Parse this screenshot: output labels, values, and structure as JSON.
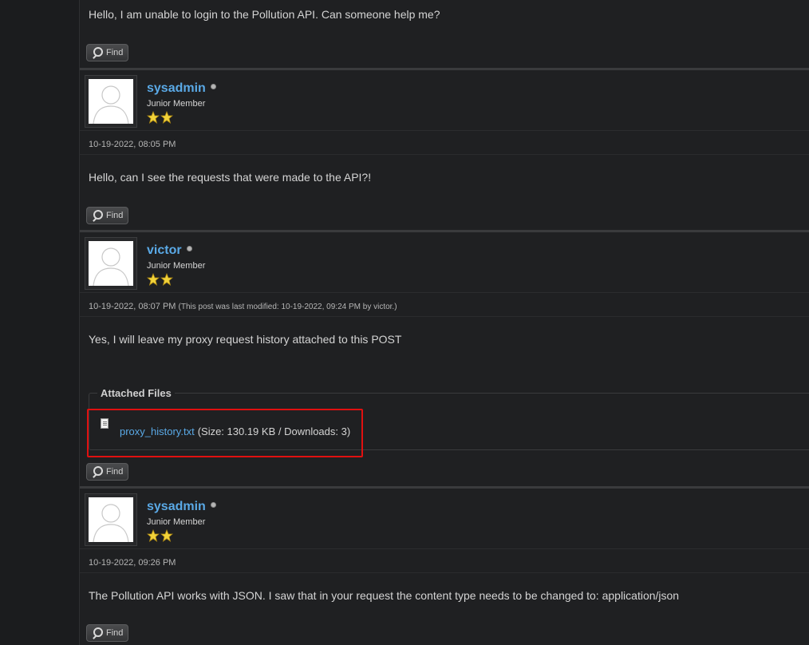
{
  "find_label": "Find",
  "posts": [
    {
      "body": "Hello, I am unable to login to the Pollution API. Can someone help me?"
    },
    {
      "author": "sysadmin",
      "usertitle": "Junior Member",
      "date": "10-19-2022, 08:05 PM",
      "body": "Hello, can I see the requests that were made to the API?!"
    },
    {
      "author": "victor",
      "usertitle": "Junior Member",
      "date": "10-19-2022, 08:07 PM",
      "modified": "(This post was last modified: 10-19-2022, 09:24 PM by victor.)",
      "body": "Yes, I will leave my proxy request history attached to this POST",
      "attachments_title": "Attached Files",
      "attachment": {
        "filename": "proxy_history.txt",
        "info": "(Size: 130.19 KB / Downloads: 3)"
      }
    },
    {
      "author": "sysadmin",
      "usertitle": "Junior Member",
      "date": "10-19-2022, 09:26 PM",
      "body": "The Pollution API works with JSON. I saw that in your request the content type needs to be changed to: application/json"
    }
  ],
  "colors": {
    "username": "#5aa9e6",
    "highlight": "#e01010",
    "background": "#1f2022"
  },
  "user_rating_stars": 2
}
